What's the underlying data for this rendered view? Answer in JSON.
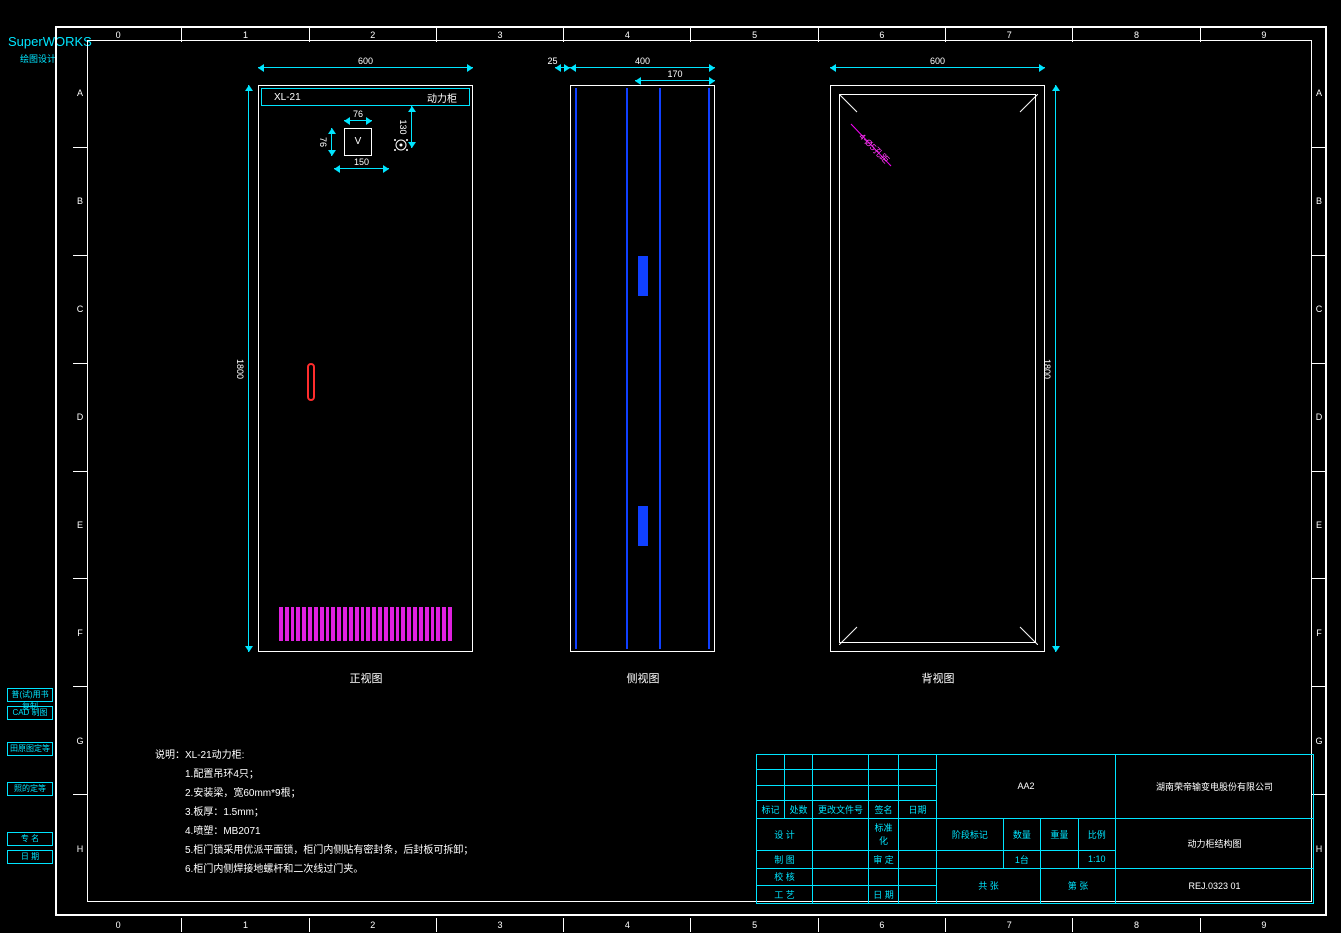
{
  "app": {
    "name": "SuperWORKS",
    "sub": "绘图设计"
  },
  "ruler": {
    "cols": [
      "0",
      "1",
      "2",
      "3",
      "4",
      "5",
      "6",
      "7",
      "8",
      "9"
    ],
    "rows": [
      "A",
      "B",
      "C",
      "D",
      "E",
      "F",
      "G",
      "H"
    ]
  },
  "left_boxes": [
    "普(试)用书复制",
    "CAD 制图",
    "田原图定等",
    "照的定等",
    "专 名",
    "日 期"
  ],
  "views": {
    "front": {
      "label": "正视图",
      "hdr_left": "XL-21",
      "hdr_right": "动力柜",
      "width_dim": "600",
      "height_dim": "1800",
      "v_label": "V",
      "dim_76": "76",
      "dim_76v": "76",
      "dim_130": "130",
      "dim_150": "150"
    },
    "side": {
      "label": "侧视图",
      "width_dim": "400",
      "inset": "170",
      "left_gap": "25"
    },
    "back": {
      "label": "背视图",
      "width_dim": "600",
      "height_dim": "1800",
      "anno": "4-Ø5孔距"
    }
  },
  "notes": {
    "hd": "说明：XL-21动力柜:",
    "items": [
      "1.配置吊环4只；",
      "2.安装梁，宽60mm*9根；",
      "3.板厚：1.5mm；",
      "4.喷塑：MB2071",
      "5.柜门锁采用优派平面锁，柜门内侧贴有密封条，后封板可拆卸；",
      "6.柜门内侧焊接地螺杆和二次线过门夹。"
    ]
  },
  "title_block": {
    "rev_hdr": [
      "标记",
      "处数",
      "更改文件号",
      "签名",
      "日期"
    ],
    "rows": [
      {
        "l": "设 计",
        "r": "标准化"
      },
      {
        "l": "制 图",
        "r": "审 定"
      },
      {
        "l": "校 核",
        "r": ""
      },
      {
        "l": "工 艺",
        "r": "日 期"
      }
    ],
    "mid_hdr": [
      "阶段标记",
      "数量",
      "重量",
      "比例"
    ],
    "qty": "1台",
    "scale": "1:10",
    "sheet_l": "共   张",
    "sheet_r": "第   张",
    "code_top": "AA2",
    "company": "湖南荣帝输变电股份有限公司",
    "title": "动力柜结构图",
    "doc": "REJ.0323 01"
  }
}
